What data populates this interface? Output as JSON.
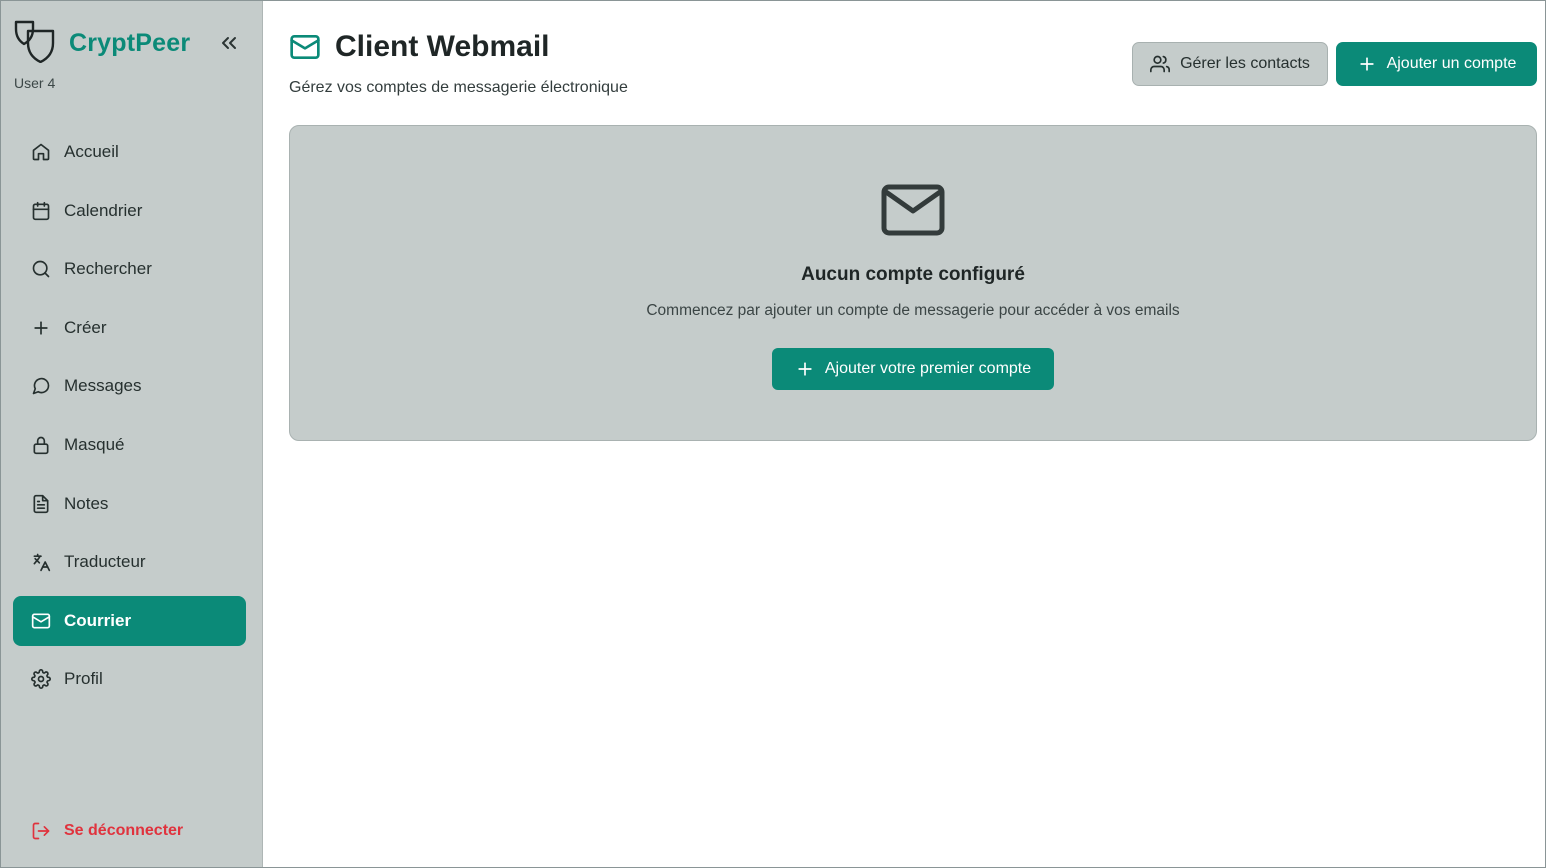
{
  "brand": {
    "name": "CryptPeer",
    "user": "User 4",
    "logo_icon": "shield-logo-icon",
    "collapse_icon": "chevrons-left-icon"
  },
  "sidebar": {
    "items": [
      {
        "label": "Accueil",
        "icon": "home-icon"
      },
      {
        "label": "Calendrier",
        "icon": "calendar-icon"
      },
      {
        "label": "Rechercher",
        "icon": "search-icon"
      },
      {
        "label": "Créer",
        "icon": "plus-icon"
      },
      {
        "label": "Messages",
        "icon": "message-circle-icon"
      },
      {
        "label": "Masqué",
        "icon": "lock-icon"
      },
      {
        "label": "Notes",
        "icon": "file-text-icon"
      },
      {
        "label": "Traducteur",
        "icon": "languages-icon"
      },
      {
        "label": "Courrier",
        "icon": "mail-icon",
        "active": true
      },
      {
        "label": "Profil",
        "icon": "settings-icon"
      }
    ],
    "logout": {
      "label": "Se déconnecter",
      "icon": "log-out-icon"
    }
  },
  "header": {
    "title": "Client Webmail",
    "subtitle": "Gérez vos comptes de messagerie électronique",
    "manage_contacts": "Gérer les contacts",
    "add_account": "Ajouter un compte"
  },
  "empty_state": {
    "title": "Aucun compte configuré",
    "description": "Commencez par ajouter un compte de messagerie pour accéder à vos emails",
    "button": "Ajouter votre premier compte"
  },
  "colors": {
    "accent": "#0b8a78",
    "sidebar_bg": "#c5cccb",
    "danger": "#e0323d"
  }
}
